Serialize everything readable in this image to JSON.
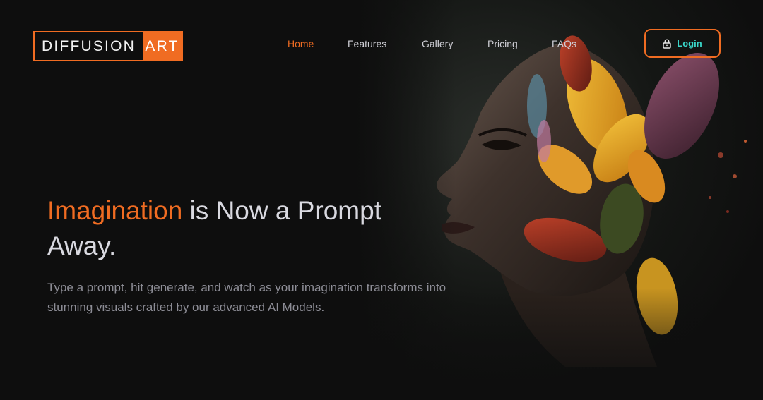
{
  "brand": {
    "name_main": "DIFFUSION",
    "name_accent": "ART",
    "accent_color": "#f06c22"
  },
  "nav": {
    "items": [
      {
        "label": "Home",
        "active": true
      },
      {
        "label": "Features",
        "active": false
      },
      {
        "label": "Gallery",
        "active": false
      },
      {
        "label": "Pricing",
        "active": false
      },
      {
        "label": "FAQs",
        "active": false
      }
    ]
  },
  "login": {
    "label": "Login",
    "icon": "lock-icon",
    "text_color": "#3ad6c9"
  },
  "hero": {
    "headline_accent": "Imagination",
    "headline_rest": " is Now a Prompt Away.",
    "subtext": "Type a prompt, hit generate, and watch as your imagination transforms into stunning visuals crafted by our advanced AI Models.",
    "image": "woman-profile-with-autumn-leaves-artwork"
  },
  "colors": {
    "background": "#0e0e0e",
    "headline_text": "#d9d9e0",
    "subtext": "#8d8d96"
  }
}
